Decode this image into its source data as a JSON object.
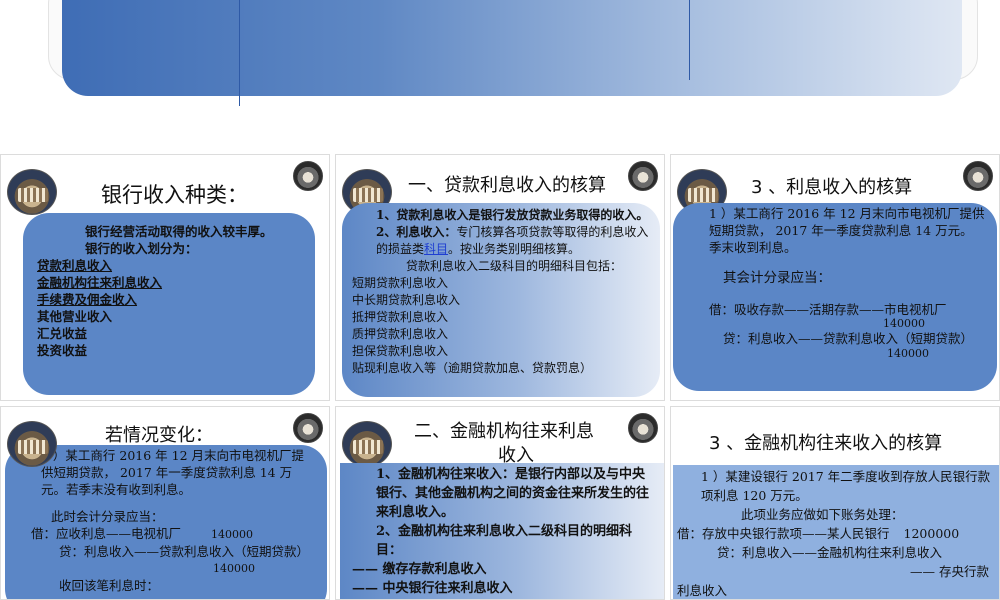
{
  "slide1": {
    "title": "银行收入种类：",
    "line1": "银行经营活动取得的收入较丰厚。",
    "line2": "银行的收入划分为：",
    "items": [
      "贷款利息收入",
      "金融机构往来利息收入",
      "手续费及佣金收入",
      "其他营业收入",
      "汇兑收益",
      "投资收益"
    ]
  },
  "slide2": {
    "title": "一、贷款利息收入的核算",
    "p1": "1、贷款利息收入是银行发放贷款业务取得的收入。",
    "p2_a": "2、利息收入：",
    "p2_b": "专门核算各项贷款等取得的利息收入的损益类",
    "p2_link": "科目",
    "p2_c": "。按业务类别明细核算。",
    "p3": "贷款利息收入二级科目的明细科目包括：",
    "items": [
      "短期贷款利息收入",
      "中长期贷款利息收入",
      "抵押贷款利息收入",
      "质押贷款利息收入",
      "担保贷款利息收入",
      "贴现利息收入等（逾期贷款加息、贷款罚息）"
    ]
  },
  "slide3": {
    "title": "3 、利息收入的核算",
    "p1": "1 ）某工商行 2016 年 12 月末向市电视机厂提供短期贷款， 2017 年一季度贷款利息 14 万元。季末收到利息。",
    "p2": "其会计分录应当：",
    "debit": "借：吸收存款——活期存款——市电视机厂",
    "debit_amt": "140000",
    "credit": "贷：利息收入——贷款利息收入（短期贷款）",
    "credit_amt": "140000"
  },
  "slide4": {
    "title": "若情况变化：",
    "p1": "2 ）某工商行 2016 年 12 月末向市电视机厂提供短期贷款， 2017 年一季度贷款利息 14 万元。若季末没有收到利息。",
    "p2": "此时会计分录应当：",
    "debit": "借：应收利息——电视机厂",
    "debit_amt": "140000",
    "credit": "贷：利息收入——贷款利息收入（短期贷款）",
    "credit_amt": "140000",
    "p3": "收回该笔利息时："
  },
  "slide5": {
    "title_l1": "二、金融机构往来利息",
    "title_l2": "收入",
    "p1": "1、金融机构往来收入：是银行内部以及与中央银行、其他金融机构之间的资金往来所发生的往来利息收入。",
    "p2": "2、金融机构往来利息收入二级科目的明细科目：",
    "items": [
      "—— 缴存存款利息收入",
      "—— 中央银行往来利息收入"
    ]
  },
  "slide6": {
    "title": "3 、金融机构往来收入的核算",
    "p1": "1 ）某建设银行 2017 年二季度收到存放人民银行款项利息 120 万元。",
    "p2": "此项业务应做如下账务处理：",
    "debit": "借：存放中央银行款项——某人民银行",
    "debit_amt": "1200000",
    "credit": "贷：利息收入——金融机构往来利息收入",
    "credit_tail": "—— 存央行款",
    "p3": "利息收入"
  }
}
